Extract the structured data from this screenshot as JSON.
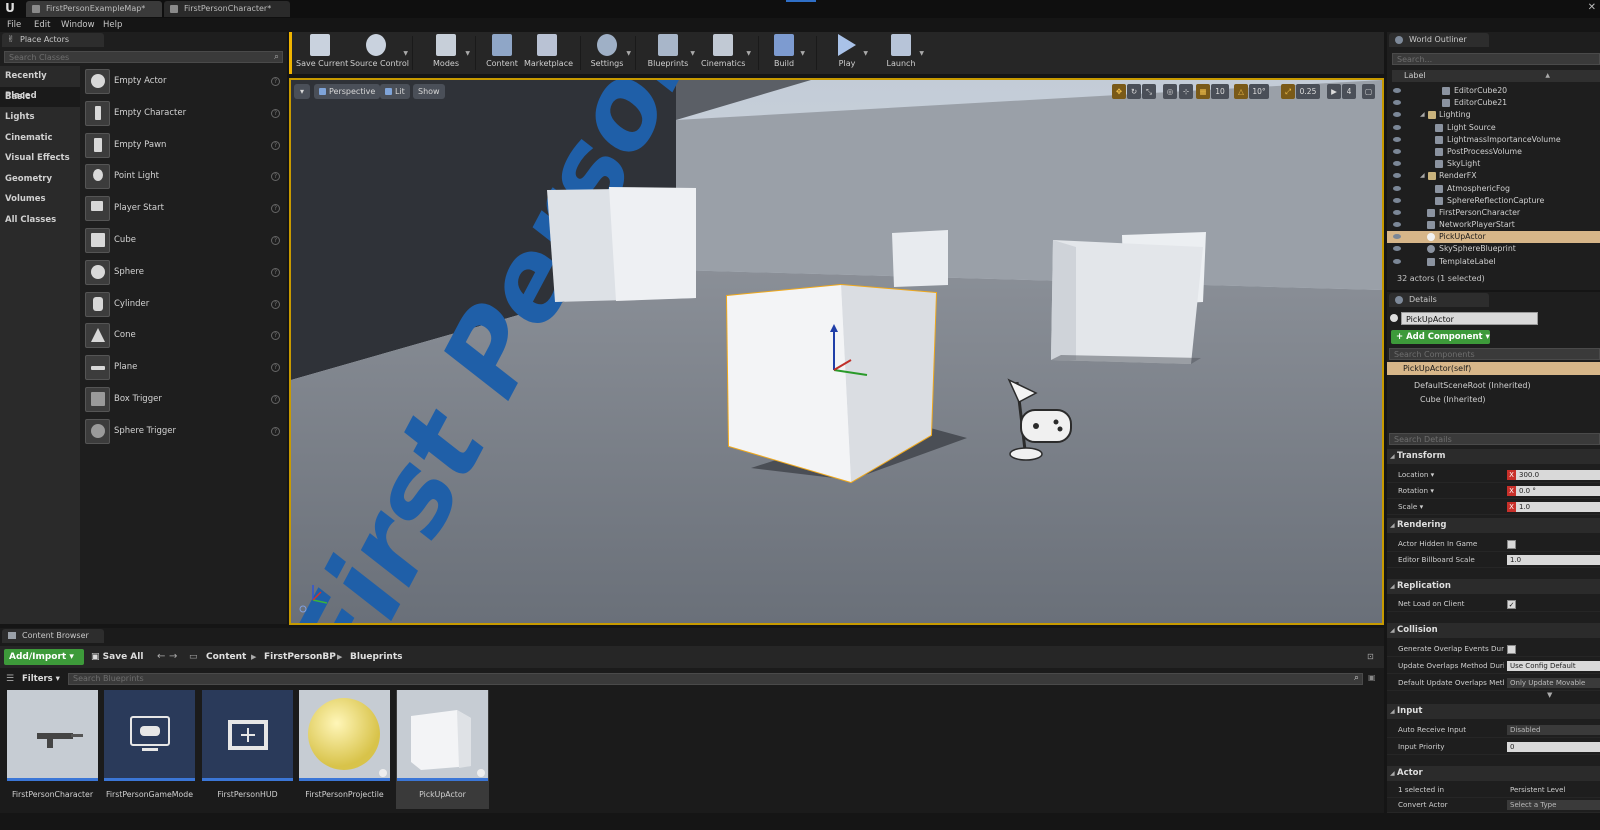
{
  "titlebar": {
    "tabs": [
      {
        "label": "FirstPersonExampleMap*"
      },
      {
        "label": "FirstPersonCharacter*"
      }
    ],
    "close_label": "✕"
  },
  "menu": [
    "File",
    "Edit",
    "Window",
    "Help"
  ],
  "place_actors": {
    "tab_label": "Place Actors",
    "search_placeholder": "Search Classes",
    "categories": [
      "Recently Placed",
      "Basic",
      "Lights",
      "Cinematic",
      "Visual Effects",
      "Geometry",
      "Volumes",
      "All Classes"
    ],
    "active_category": "Basic",
    "actors": [
      "Empty Actor",
      "Empty Character",
      "Empty Pawn",
      "Point Light",
      "Player Start",
      "Cube",
      "Sphere",
      "Cylinder",
      "Cone",
      "Plane",
      "Box Trigger",
      "Sphere Trigger"
    ]
  },
  "toolbar": {
    "buttons": [
      "Save Current",
      "Source Control",
      "Modes",
      "Content",
      "Marketplace",
      "Settings",
      "Blueprints",
      "Cinematics",
      "Build",
      "Play",
      "Launch"
    ]
  },
  "viewport": {
    "perspective_label": "Perspective",
    "lit_label": "Lit",
    "show_label": "Show",
    "grid_snap": "10",
    "rotation_snap": "10°",
    "scale_snap": "0.25",
    "camera_speed": "4",
    "floor_text": "First Person"
  },
  "world_outliner": {
    "tab_label": "World Outliner",
    "search_placeholder": "Search...",
    "column_label": "Label",
    "rows": [
      {
        "label": "EditorCube20",
        "selected": false
      },
      {
        "label": "EditorCube21",
        "selected": false
      },
      {
        "label": "Lighting",
        "selected": false
      },
      {
        "label": "Light Source",
        "selected": false
      },
      {
        "label": "LightmassImportanceVolume",
        "selected": false
      },
      {
        "label": "PostProcessVolume",
        "selected": false
      },
      {
        "label": "SkyLight",
        "selected": false
      },
      {
        "label": "RenderFX",
        "selected": false
      },
      {
        "label": "AtmosphericFog",
        "selected": false
      },
      {
        "label": "SphereReflectionCapture",
        "selected": false
      },
      {
        "label": "FirstPersonCharacter",
        "selected": false
      },
      {
        "label": "NetworkPlayerStart",
        "selected": false
      },
      {
        "label": "PickUpActor",
        "selected": true
      },
      {
        "label": "SkySphereBlueprint",
        "selected": false
      },
      {
        "label": "TemplateLabel",
        "selected": false
      }
    ],
    "count": "32 actors (1 selected)"
  },
  "details": {
    "tab_label": "Details",
    "actor_name": "PickUpActor",
    "add_component_label": "+ Add Component ▾",
    "search_components_placeholder": "Search Components",
    "components": [
      "PickUpActor(self)",
      "DefaultSceneRoot (Inherited)",
      "Cube (Inherited)"
    ],
    "search_details_placeholder": "Search Details",
    "sections": {
      "transform": "Transform",
      "rendering": "Rendering",
      "replication": "Replication",
      "collision": "Collision",
      "input": "Input",
      "actor": "Actor"
    },
    "transform": {
      "location_label": "Location ▾",
      "location_value": "300.0",
      "rotation_label": "Rotation ▾",
      "rotation_value": "0.0 °",
      "scale_label": "Scale ▾",
      "scale_value": "1.0"
    },
    "rendering": {
      "hidden_label": "Actor Hidden In Game",
      "billboard_label": "Editor Billboard Scale",
      "billboard_value": "1.0"
    },
    "replication": {
      "net_load_label": "Net Load on Client",
      "net_load_check": "✓"
    },
    "collision": {
      "overlap_label": "Generate Overlap Events During L",
      "update_label": "Update Overlaps Method During",
      "update_value": "Use Config Default",
      "default_label": "Default Update Overlaps Method",
      "default_value": "Only Update Movable"
    },
    "input": {
      "auto_label": "Auto Receive Input",
      "auto_value": "Disabled",
      "priority_label": "Input Priority",
      "priority_value": "0"
    },
    "actor": {
      "selected_label": "1 selected in",
      "selected_value": "Persistent Level",
      "convert_label": "Convert Actor",
      "convert_value": "Select a Type"
    }
  },
  "content_browser": {
    "tab_label": "Content Browser",
    "add_import_label": "Add/Import ▾",
    "save_all_label": "Save All",
    "breadcrumb": [
      "Content",
      "FirstPersonBP",
      "Blueprints"
    ],
    "filters_label": "Filters ▾",
    "search_placeholder": "Search Blueprints",
    "assets": [
      "FirstPersonCharacter",
      "FirstPersonGameMode",
      "FirstPersonHUD",
      "FirstPersonProjectile",
      "PickUpActor"
    ],
    "selected_asset": "PickUpActor"
  },
  "colors": {
    "accent_selected": "#d7b689",
    "add_green": "#3d9a3a",
    "viewport_border": "#c79a00",
    "asset_bar": "#3b76d6",
    "floor_text_blue": "#1f5fa8"
  }
}
